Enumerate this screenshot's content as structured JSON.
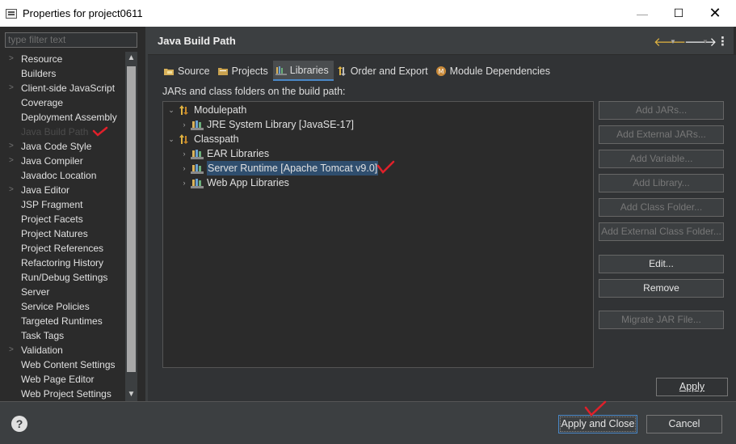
{
  "window": {
    "title": "Properties for project0611",
    "controls": {
      "minimize": "—",
      "maximize": "☐",
      "close": "✕"
    }
  },
  "left": {
    "filter_placeholder": "type filter text",
    "items": [
      {
        "label": "Resource",
        "expandable": true
      },
      {
        "label": "Builders",
        "expandable": false
      },
      {
        "label": "Client-side JavaScript",
        "expandable": true
      },
      {
        "label": "Coverage",
        "expandable": false
      },
      {
        "label": "Deployment Assembly",
        "expandable": false
      },
      {
        "label": "Java Build Path",
        "expandable": false,
        "selected": true
      },
      {
        "label": "Java Code Style",
        "expandable": true
      },
      {
        "label": "Java Compiler",
        "expandable": true
      },
      {
        "label": "Javadoc Location",
        "expandable": false
      },
      {
        "label": "Java Editor",
        "expandable": true
      },
      {
        "label": "JSP Fragment",
        "expandable": false
      },
      {
        "label": "Project Facets",
        "expandable": false
      },
      {
        "label": "Project Natures",
        "expandable": false
      },
      {
        "label": "Project References",
        "expandable": false
      },
      {
        "label": "Refactoring History",
        "expandable": false
      },
      {
        "label": "Run/Debug Settings",
        "expandable": false
      },
      {
        "label": "Server",
        "expandable": false
      },
      {
        "label": "Service Policies",
        "expandable": false
      },
      {
        "label": "Targeted Runtimes",
        "expandable": false
      },
      {
        "label": "Task Tags",
        "expandable": false
      },
      {
        "label": "Validation",
        "expandable": true
      },
      {
        "label": "Web Content Settings",
        "expandable": false
      },
      {
        "label": "Web Page Editor",
        "expandable": false
      },
      {
        "label": "Web Project Settings",
        "expandable": false
      }
    ]
  },
  "header": {
    "title": "Java Build Path"
  },
  "tabs": [
    {
      "label": "Source",
      "icon": "source-folder-icon",
      "active": false
    },
    {
      "label": "Projects",
      "icon": "projects-icon",
      "active": false
    },
    {
      "label": "Libraries",
      "icon": "libraries-icon",
      "active": true
    },
    {
      "label": "Order and Export",
      "icon": "order-export-icon",
      "active": false
    },
    {
      "label": "Module Dependencies",
      "icon": "module-icon",
      "active": false
    }
  ],
  "description": "JARs and class folders on the build path:",
  "build_tree": [
    {
      "label": "Modulepath",
      "level": 0,
      "twisty": "expanded"
    },
    {
      "label": "JRE System Library [JavaSE-17]",
      "level": 1,
      "twisty": "collapsed"
    },
    {
      "label": "Classpath",
      "level": 0,
      "twisty": "expanded"
    },
    {
      "label": "EAR Libraries",
      "level": 1,
      "twisty": "collapsed"
    },
    {
      "label": "Server Runtime [Apache Tomcat v9.0]",
      "level": 1,
      "twisty": "collapsed",
      "highlighted": true
    },
    {
      "label": "Web App Libraries",
      "level": 1,
      "twisty": "collapsed"
    }
  ],
  "side_buttons": [
    {
      "label": "Add JARs...",
      "enabled": false
    },
    {
      "label": "Add External JARs...",
      "enabled": false
    },
    {
      "label": "Add Variable...",
      "enabled": false
    },
    {
      "label": "Add Library...",
      "enabled": false
    },
    {
      "label": "Add Class Folder...",
      "enabled": false
    },
    {
      "label": "Add External Class Folder...",
      "enabled": false
    },
    {
      "label": "Edit...",
      "enabled": true
    },
    {
      "label": "Remove",
      "enabled": true
    },
    {
      "label": "Migrate JAR File...",
      "enabled": false
    }
  ],
  "apply_label": "Apply",
  "footer": {
    "help": "?",
    "apply_close": "Apply and Close",
    "cancel": "Cancel"
  },
  "colors": {
    "accent": "#4a88c7",
    "annotation": "#e0202a",
    "background": "#3c3f41",
    "panel": "#2b2b2b"
  }
}
